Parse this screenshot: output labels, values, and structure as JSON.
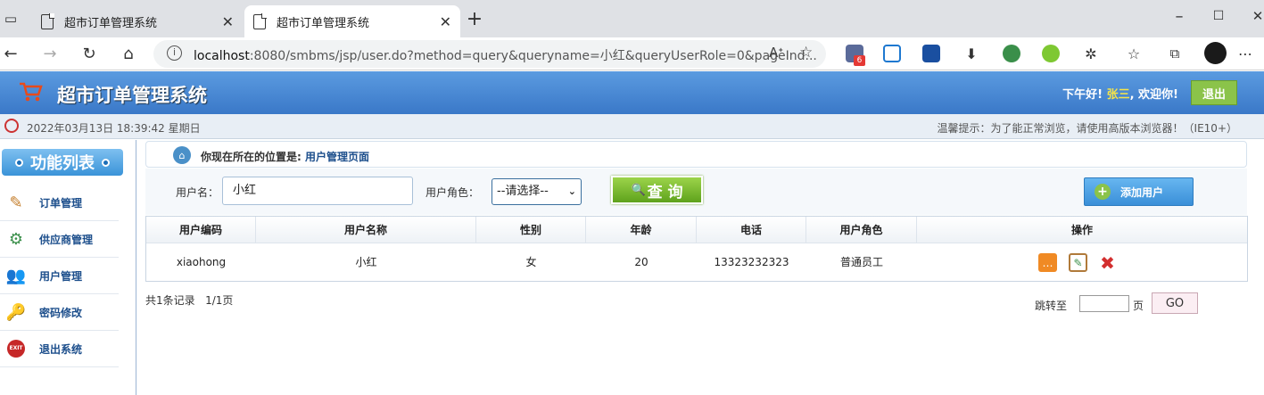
{
  "browser": {
    "tabs": [
      {
        "title": "超市订单管理系统"
      },
      {
        "title": "超市订单管理系统"
      }
    ],
    "url_host": "localhost",
    "url_rest": ":8080/smbms/jsp/user.do?method=query&queryname=小红&queryUserRole=0&pageInd...",
    "ext_badge": "6"
  },
  "header": {
    "title": "超市订单管理系统",
    "greeting_prefix": "下午好!",
    "username": "张三",
    "greeting_suffix": ", 欢迎你!",
    "logout_label": "退出"
  },
  "datebar": {
    "datetime": "2022年03月13日 18:39:42 星期日",
    "tip": "温馨提示：为了能正常浏览，请使用高版本浏览器！（IE10+）"
  },
  "sidebar": {
    "title": "功能列表",
    "items": [
      {
        "label": "订单管理"
      },
      {
        "label": "供应商管理"
      },
      {
        "label": "用户管理"
      },
      {
        "label": "密码修改"
      },
      {
        "label": "退出系统"
      }
    ]
  },
  "breadcrumb": {
    "prefix": "你现在所在的位置是:",
    "current": "用户管理页面"
  },
  "search": {
    "username_label": "用户名：",
    "username_value": "小红",
    "role_label": "用户角色：",
    "role_selected": "--请选择--",
    "query_label": "查 询",
    "add_label": "添加用户"
  },
  "table": {
    "headers": [
      "用户编码",
      "用户名称",
      "性别",
      "年龄",
      "电话",
      "用户角色",
      "操作"
    ],
    "rows": [
      {
        "code": "xiaohong",
        "name": "小红",
        "gender": "女",
        "age": "20",
        "phone": "13323232323",
        "role": "普通员工"
      }
    ]
  },
  "pagination": {
    "summary": "共1条记录   1/1页",
    "jump_label": "跳转至",
    "page_label": "页",
    "go_label": "GO"
  }
}
